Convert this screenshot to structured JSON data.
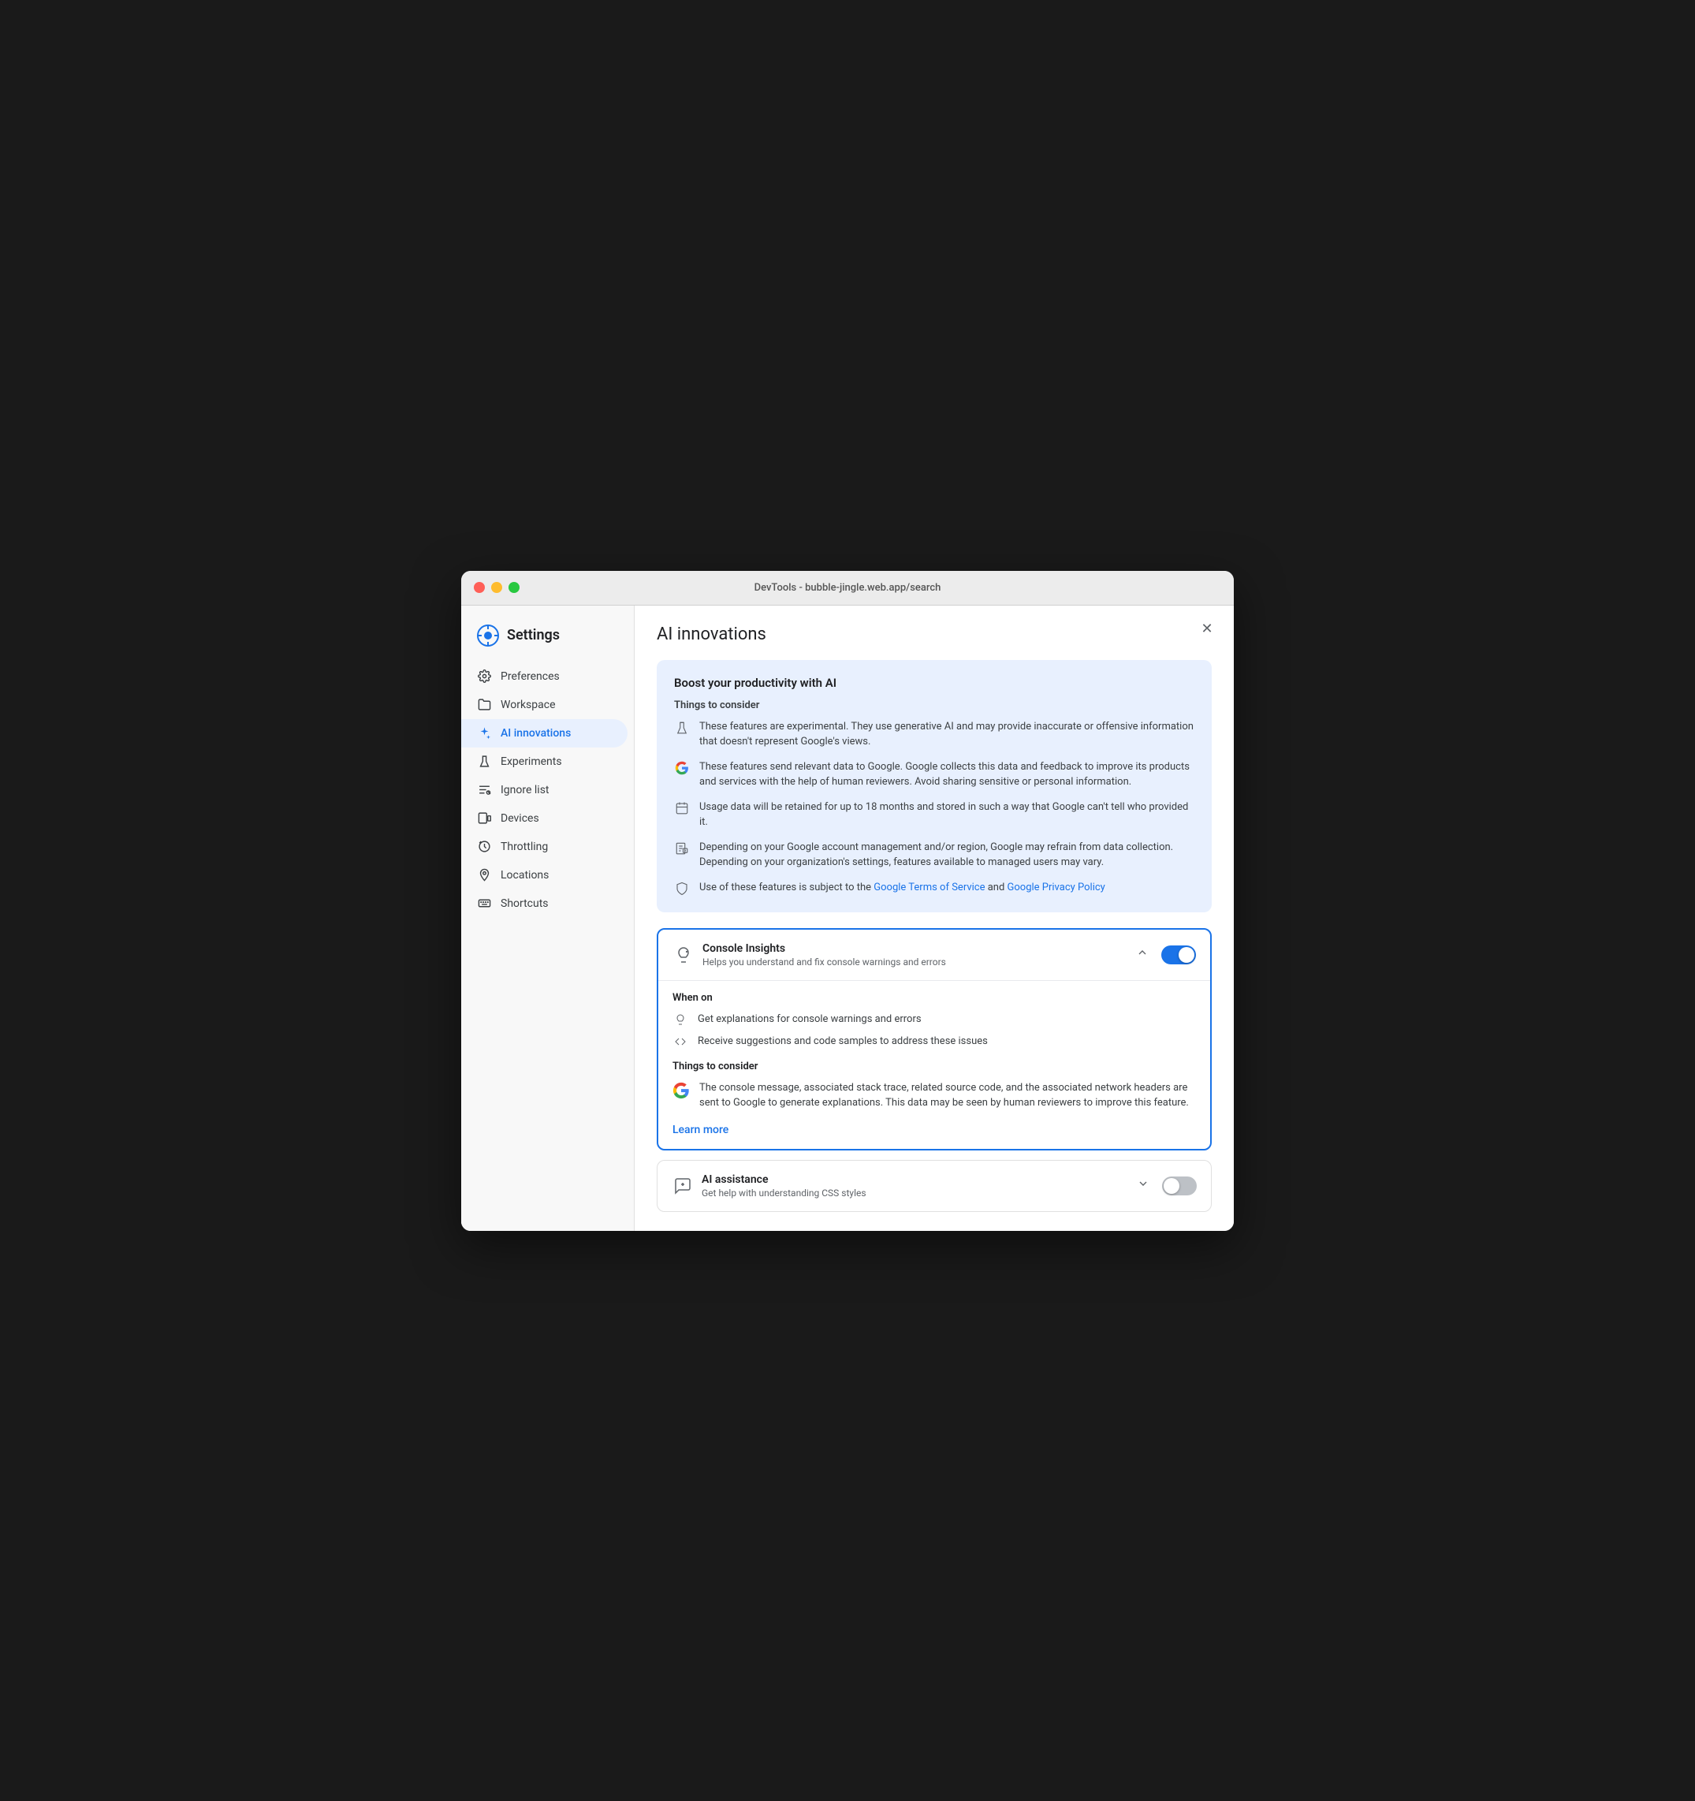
{
  "window": {
    "title": "DevTools - bubble-jingle.web.app/search"
  },
  "sidebar": {
    "title": "Settings",
    "items": [
      {
        "id": "preferences",
        "label": "Preferences",
        "icon": "gear"
      },
      {
        "id": "workspace",
        "label": "Workspace",
        "icon": "folder"
      },
      {
        "id": "ai-innovations",
        "label": "AI innovations",
        "icon": "sparkle",
        "active": true
      },
      {
        "id": "experiments",
        "label": "Experiments",
        "icon": "flask"
      },
      {
        "id": "ignore-list",
        "label": "Ignore list",
        "icon": "ignore"
      },
      {
        "id": "devices",
        "label": "Devices",
        "icon": "devices"
      },
      {
        "id": "throttling",
        "label": "Throttling",
        "icon": "throttling"
      },
      {
        "id": "locations",
        "label": "Locations",
        "icon": "location"
      },
      {
        "id": "shortcuts",
        "label": "Shortcuts",
        "icon": "keyboard"
      }
    ]
  },
  "main": {
    "title": "AI innovations",
    "info_box": {
      "title": "Boost your productivity with AI",
      "things_to_consider": "Things to consider",
      "items": [
        {
          "icon": "experiment",
          "text": "These features are experimental. They use generative AI and may provide inaccurate or offensive information that doesn't represent Google's views."
        },
        {
          "icon": "google",
          "text": "These features send relevant data to Google. Google collects this data and feedback to improve its products and services with the help of human reviewers. Avoid sharing sensitive or personal information."
        },
        {
          "icon": "calendar",
          "text": "Usage data will be retained for up to 18 months and stored in such a way that Google can't tell who provided it."
        },
        {
          "icon": "policy",
          "text": "Depending on your Google account management and/or region, Google may refrain from data collection. Depending on your organization's settings, features available to managed users may vary."
        },
        {
          "icon": "shield",
          "text_before": "Use of these features is subject to the ",
          "link1_text": "Google Terms of Service",
          "link1_href": "#",
          "text_middle": " and ",
          "link2_text": "Google Privacy Policy",
          "link2_href": "#",
          "text_after": ""
        }
      ]
    },
    "console_insights": {
      "name": "Console Insights",
      "description": "Helps you understand and fix console warnings and errors",
      "enabled": true,
      "expanded": true,
      "when_on_title": "When on",
      "when_on_items": [
        {
          "icon": "lightbulb",
          "text": "Get explanations for console warnings and errors"
        },
        {
          "icon": "code",
          "text": "Receive suggestions and code samples to address these issues"
        }
      ],
      "things_title": "Things to consider",
      "things_items": [
        {
          "icon": "google",
          "text": "The console message, associated stack trace, related source code, and the associated network headers are sent to Google to generate explanations. This data may be seen by human reviewers to improve this feature."
        }
      ],
      "learn_more": "Learn more"
    },
    "ai_assistance": {
      "name": "AI assistance",
      "description": "Get help with understanding CSS styles",
      "enabled": false,
      "expanded": false
    }
  }
}
